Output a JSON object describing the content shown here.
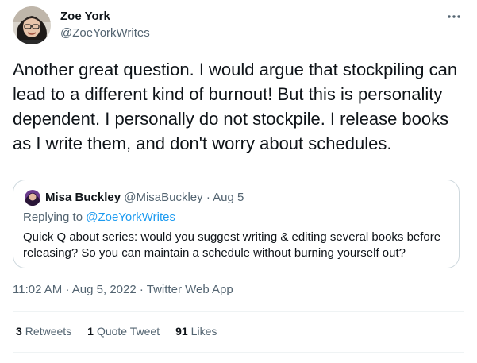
{
  "author": {
    "name": "Zoe York",
    "handle": "@ZoeYorkWrites"
  },
  "tweet_text": "Another great question. I would argue that stockpiling can lead to a different kind of burnout! But this is personality dependent. I personally do not stockpile. I release books as I write them, and don't worry about schedules.",
  "quoted": {
    "name": "Misa Buckley",
    "handle": "@MisaBuckley",
    "separator": "·",
    "date": "Aug 5",
    "replying_label": "Replying to",
    "replying_handle": "@ZoeYorkWrites",
    "text": "Quick Q about series: would you suggest writing & editing several books before releasing? So you can maintain a schedule without burning yourself out?"
  },
  "meta": {
    "time": "11:02 AM",
    "sep1": "·",
    "date": "Aug 5, 2022",
    "sep2": "·",
    "source": "Twitter Web App"
  },
  "stats": {
    "retweets_count": "3",
    "retweets_label": "Retweets",
    "quotes_count": "1",
    "quotes_label": "Quote Tweet",
    "likes_count": "91",
    "likes_label": "Likes"
  },
  "icons": {
    "more": "more-horizontal-icon"
  },
  "colors": {
    "text": "#0f1419",
    "secondary": "#536471",
    "link": "#1d9bf0",
    "border": "#cfd9de"
  }
}
